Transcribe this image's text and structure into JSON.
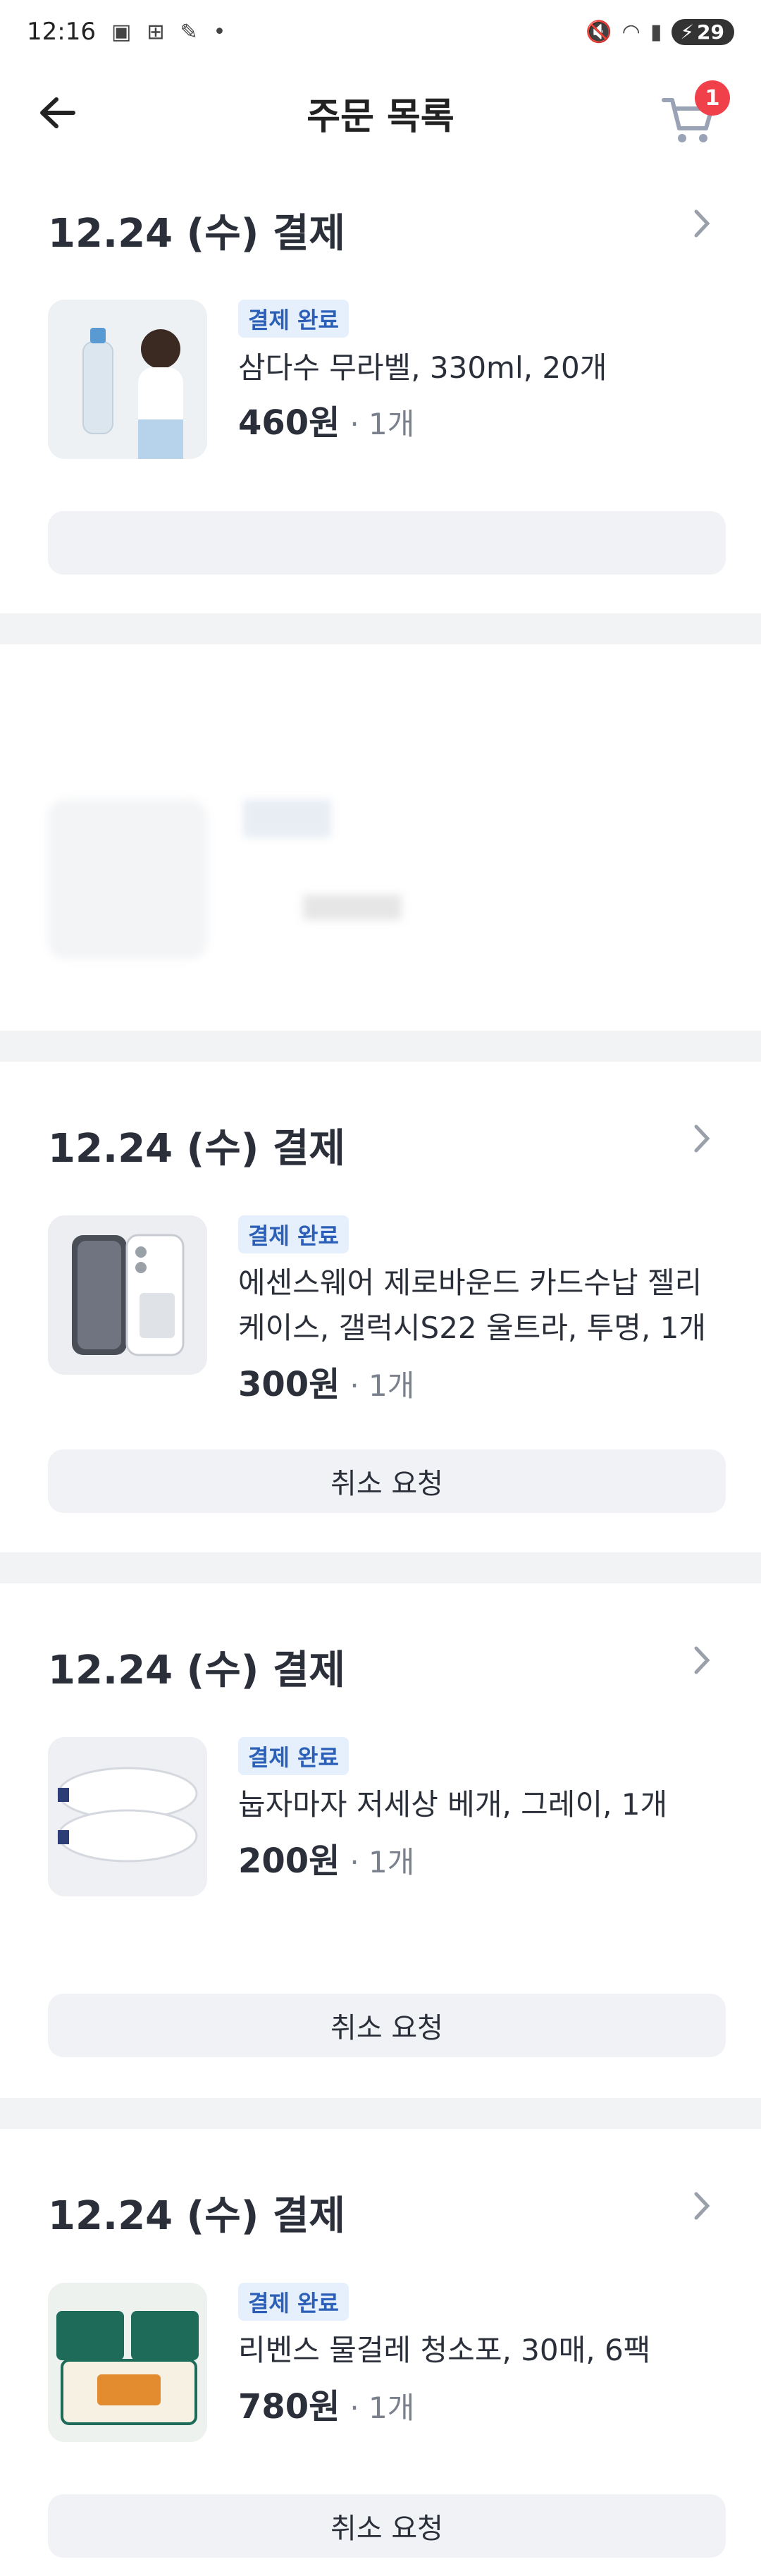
{
  "status_bar": {
    "time": "12:16",
    "battery": "29"
  },
  "header": {
    "title": "주문 목록",
    "cart_count": "1"
  },
  "orders": [
    {
      "date": "12.24 (수) 결제",
      "status": "결제 완료",
      "product_name": "삼다수 무라벨, 330ml, 20개",
      "price": "460원",
      "qty": "· 1개",
      "action": ""
    },
    {
      "date": "12.24 (수) 결제",
      "status": "결제 완료",
      "product_name": "에센스웨어 제로바운드 카드수납 젤리 케이스, 갤럭시S22 울트라, 투명, 1개",
      "price": "300원",
      "qty": "· 1개",
      "action": "취소 요청"
    },
    {
      "date": "12.24 (수) 결제",
      "status": "결제 완료",
      "product_name": "눕자마자 저세상  베개, 그레이, 1개",
      "price": "200원",
      "qty": "· 1개",
      "action": "취소 요청"
    },
    {
      "date": "12.24 (수) 결제",
      "status": "결제 완료",
      "product_name": "리벤스 물걸레 청소포, 30매, 6팩",
      "price": "780원",
      "qty": "· 1개",
      "action": "취소 요청"
    }
  ]
}
